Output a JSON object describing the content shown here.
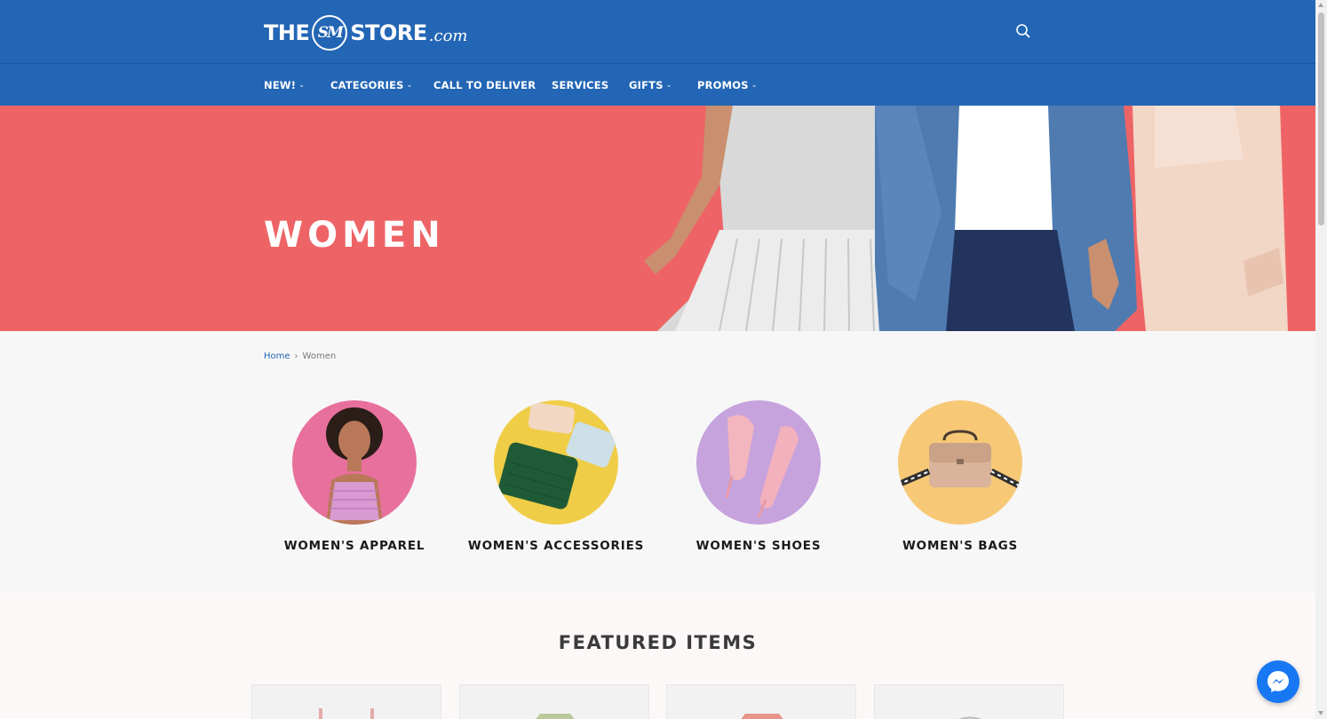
{
  "header": {
    "logo": {
      "the": "THE",
      "seal": "SM",
      "store": "STORE",
      "dotcom": ".com"
    },
    "search_icon": "search-icon"
  },
  "nav": {
    "items": [
      {
        "label": "NEW!",
        "has_dropdown": true
      },
      {
        "label": "CATEGORIES",
        "has_dropdown": true
      },
      {
        "label": "CALL TO DELIVER",
        "has_dropdown": false
      },
      {
        "label": "SERVICES",
        "has_dropdown": false
      },
      {
        "label": "GIFTS",
        "has_dropdown": true
      },
      {
        "label": "PROMOS",
        "has_dropdown": true
      }
    ],
    "chevron": "⌄"
  },
  "hero": {
    "title": "WOMEN"
  },
  "breadcrumb": {
    "home": "Home",
    "separator": "›",
    "current": "Women"
  },
  "categories": [
    {
      "label": "WOMEN'S APPAREL",
      "image": "woman-in-pink-top-photo"
    },
    {
      "label": "WOMEN'S ACCESSORIES",
      "image": "wallets-photo"
    },
    {
      "label": "WOMEN'S SHOES",
      "image": "pink-heels-photo"
    },
    {
      "label": "WOMEN'S BAGS",
      "image": "beige-handbag-photo"
    }
  ],
  "featured": {
    "title": "FEATURED ITEMS"
  },
  "colors": {
    "brand_blue": "#2366b5",
    "hero_coral": "#ee6466",
    "messenger_blue": "#1877f2"
  }
}
